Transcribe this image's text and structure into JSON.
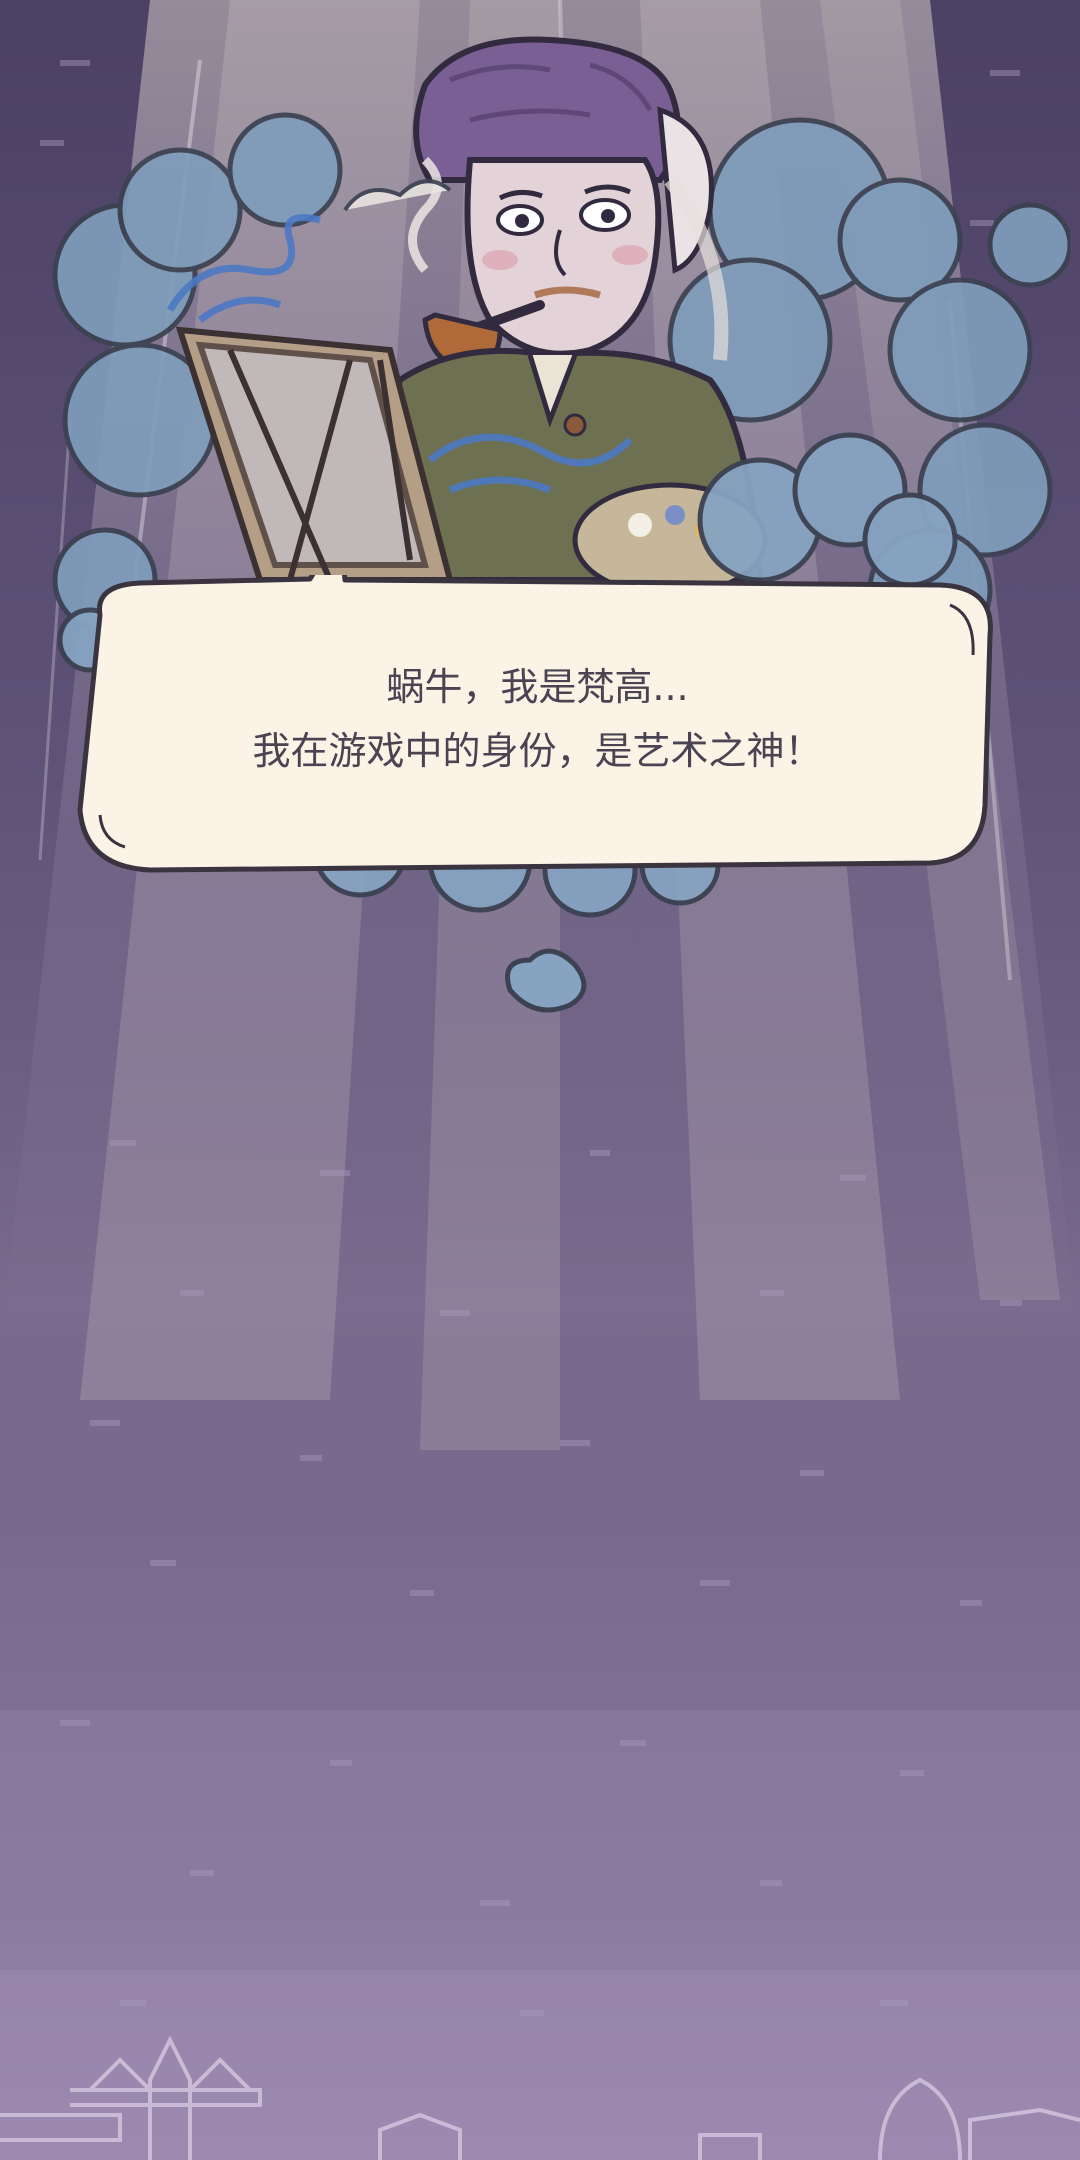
{
  "dialogue": {
    "line1": "蜗牛，我是梵高...",
    "line2": "我在游戏中的身份，是艺术之神！"
  },
  "character": {
    "name": "梵高"
  },
  "colors": {
    "background_top": "#4b4163",
    "background_bottom": "#9c88b0",
    "bubble_fill": "#fbf4e6",
    "bubble_outline": "#3a3440",
    "cloud": "#7f9dbb",
    "hat": "#7a5f95"
  }
}
